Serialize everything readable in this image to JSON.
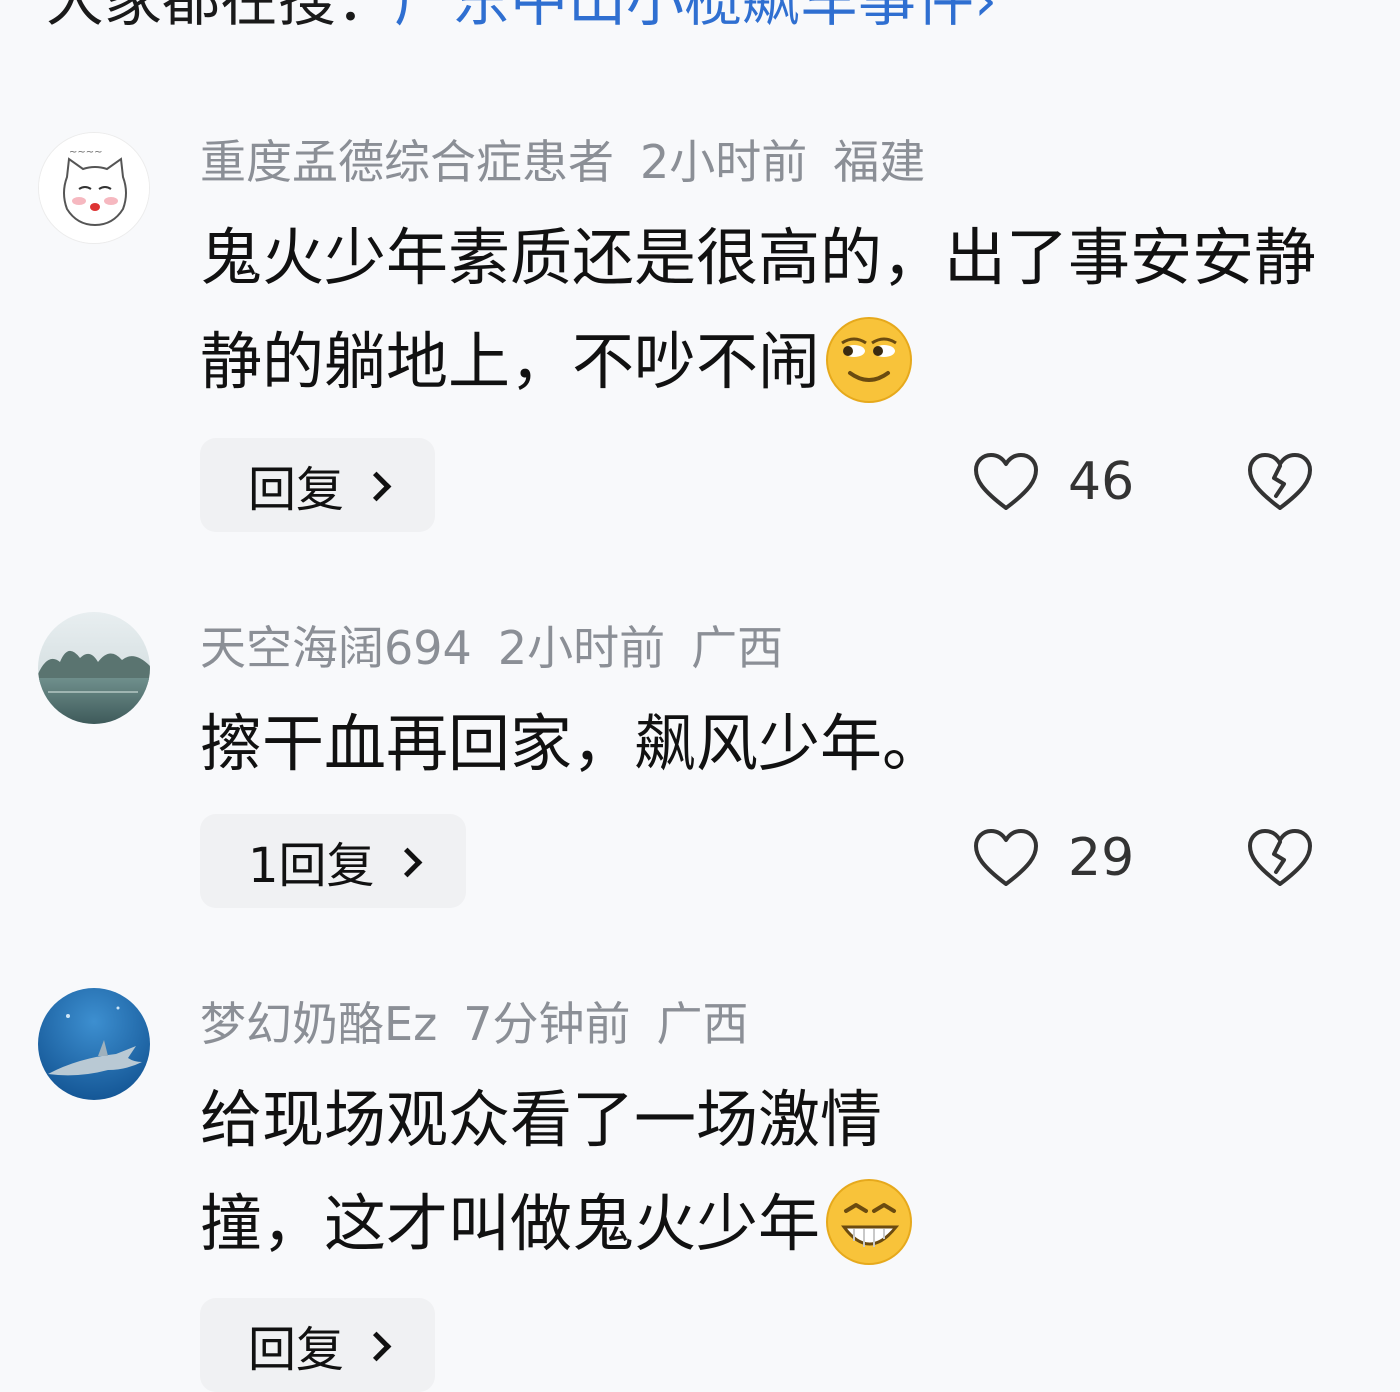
{
  "header": {
    "prefix": "大家都在搜：",
    "topic_link": "广东中山小榄飙车事件",
    "suffix": "›"
  },
  "comments": [
    {
      "username": "重度孟德综合症患者",
      "time": "2小时前",
      "location": "福建",
      "text": "鬼火少年素质还是很高的，出了事安安静静的躺地上，不吵不闹",
      "emoji": "smirk-emoji",
      "reply_label": "回复",
      "likes": "46",
      "avatar": "cartoon-cat-avatar"
    },
    {
      "username": "天空海阔694",
      "time": "2小时前",
      "location": "广西",
      "text": "擦干血再回家，飙风少年。",
      "emoji": "",
      "reply_label": "1回复",
      "likes": "29",
      "avatar": "lake-landscape-avatar"
    },
    {
      "username": "梦幻奶酪Ez",
      "time": "7分钟前",
      "location": "广西",
      "text": "给现场观众看了一场激情撞，这才叫做鬼火少年",
      "emoji": "grin-emoji",
      "reply_label": "回复",
      "likes": "",
      "avatar": "shark-underwater-avatar"
    }
  ],
  "colors": {
    "background": "#f8f9fb",
    "meta_gray": "#8b8f96",
    "link_blue": "#2f6fd1",
    "reply_bg": "#f0f1f3"
  }
}
